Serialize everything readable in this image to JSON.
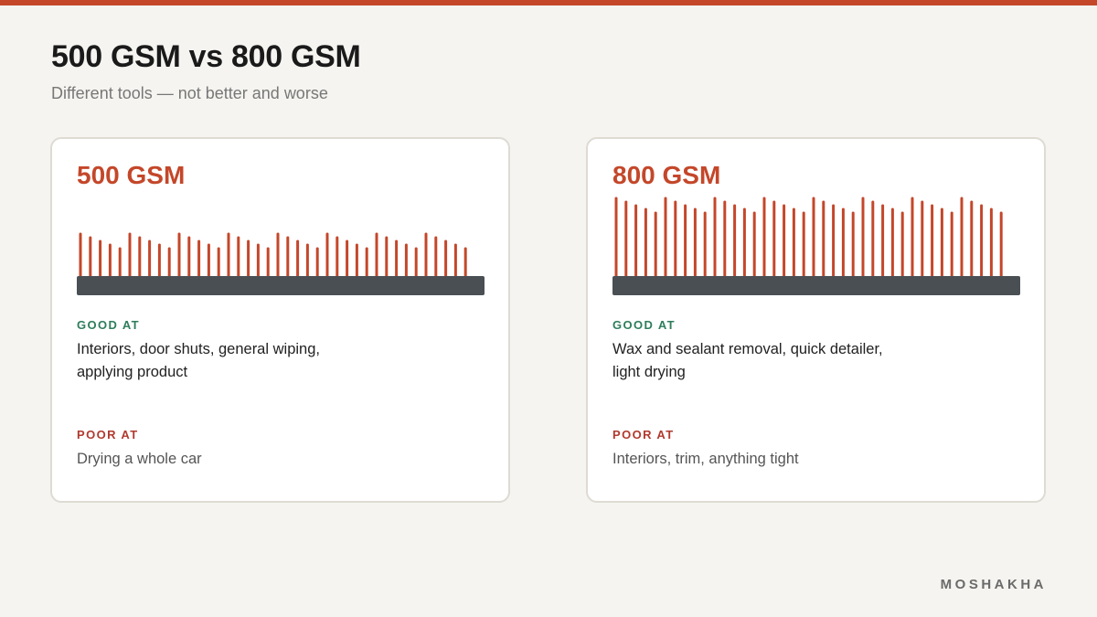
{
  "header": {
    "title": "500 GSM vs 800 GSM",
    "subtitle": "Different tools — not better and worse"
  },
  "cards": [
    {
      "title": "500 GSM",
      "good_label": "GOOD AT",
      "good_text": "Interiors, door shuts, general wiping, applying product",
      "poor_label": "POOR AT",
      "poor_text": "Drying a whole car"
    },
    {
      "title": "800 GSM",
      "good_label": "GOOD AT",
      "good_text": "Wax and sealant removal, quick detailer, light drying",
      "poor_label": "POOR AT",
      "poor_text": "Interiors, trim, anything tight"
    }
  ],
  "colors": {
    "accent": "#c4472a",
    "good": "#2e7d5b",
    "poor": "#b03a2e",
    "base": "#4a4f54"
  },
  "brand": "MOSHAKHA"
}
